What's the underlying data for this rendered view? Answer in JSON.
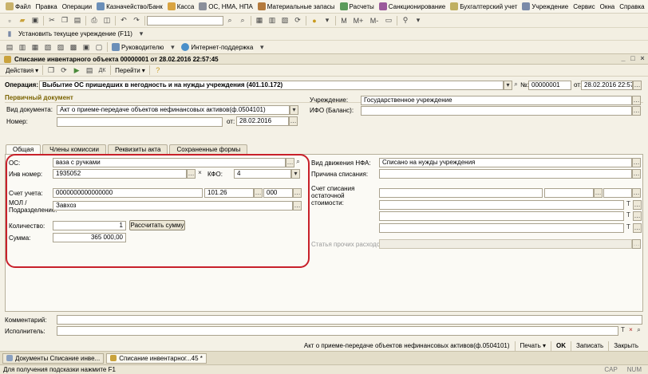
{
  "menubar": {
    "items": [
      "Файл",
      "Правка",
      "Операции",
      "Казначейство/Банк",
      "Касса",
      "ОС, НМА, НПА",
      "Материальные запасы",
      "Расчеты",
      "Санкционирование",
      "Бухгалтерский учет",
      "Учреждение",
      "Сервис",
      "Окна",
      "Справка"
    ]
  },
  "toolbar2": {
    "set_institution": "Установить текущее учреждение (F11)"
  },
  "toolbar3": {
    "manager": "Руководителю",
    "support": "Интернет-поддержка"
  },
  "window": {
    "title": "Списание инвентарного объекта 00000001 от 28.02.2016 22:57:45"
  },
  "actions": {
    "actions_label": "Действия",
    "go_label": "Перейти"
  },
  "header": {
    "operation_label": "Операция:",
    "operation_value": "Выбытие ОС пришедших в негодность и на нужды учреждения (401.10.172)",
    "number_label": "№:",
    "number_value": "00000001",
    "from_label": "от:",
    "date_value": "28.02.2016 22:57:45"
  },
  "primary_doc": {
    "section": "Первичный документ",
    "doc_type_label": "Вид документа:",
    "doc_type_value": "Акт о приеме-передаче объектов нефинансовых активов(ф.0504101)",
    "num_label": "Номер:",
    "num_value": "",
    "from_label": "от:",
    "date_value": "28.02.2016",
    "institution_label": "Учреждение:",
    "institution_value": "Государственное учреждение",
    "ifo_label": "ИФО (Баланс):",
    "ifo_value": ""
  },
  "tabs": [
    "Общая",
    "Члены комиссии",
    "Реквизиты акта",
    "Сохраненные формы"
  ],
  "general": {
    "os_label": "ОС:",
    "os_value": "ваза с ручками",
    "inv_label": "Инв номер:",
    "inv_value": "1935052",
    "kfo_label": "КФО:",
    "kfo_value": "4",
    "account_label": "Счет учета:",
    "account_code": "0000000000000000",
    "account_num": "101.26",
    "account_ext": "000",
    "mol_label": "МОЛ / Подразделение:",
    "mol_value": "Завхоз",
    "qty_label": "Количество:",
    "qty_value": "1",
    "calc_button": "Рассчитать сумму",
    "sum_label": "Сумма:",
    "sum_value": "365 000,00",
    "movement_label": "Вид движения НФА:",
    "movement_value": "Списано на нужды учреждения",
    "reason_label": "Причина списания:",
    "reason_value": "",
    "residual_label": "Счет списания остаточной стоимости:",
    "other_exp_label": "Статья прочих расходов:"
  },
  "footer": {
    "comment_label": "Комментарий:",
    "comment_value": "",
    "executor_label": "Исполнитель:",
    "executor_value": ""
  },
  "bottom_bar": {
    "act": "Акт о приеме-передаче объектов нефинансовых активов(ф.0504101)",
    "print": "Печать",
    "ok": "OK",
    "save": "Записать",
    "close": "Закрыть"
  },
  "taskbar": {
    "tab1": "Документы Списание инве...",
    "tab2": "Списание инвентарног...45 *"
  },
  "statusbar": {
    "hint": "Для получения подсказки нажмите F1",
    "caps": "CAP",
    "num": "NUM"
  }
}
